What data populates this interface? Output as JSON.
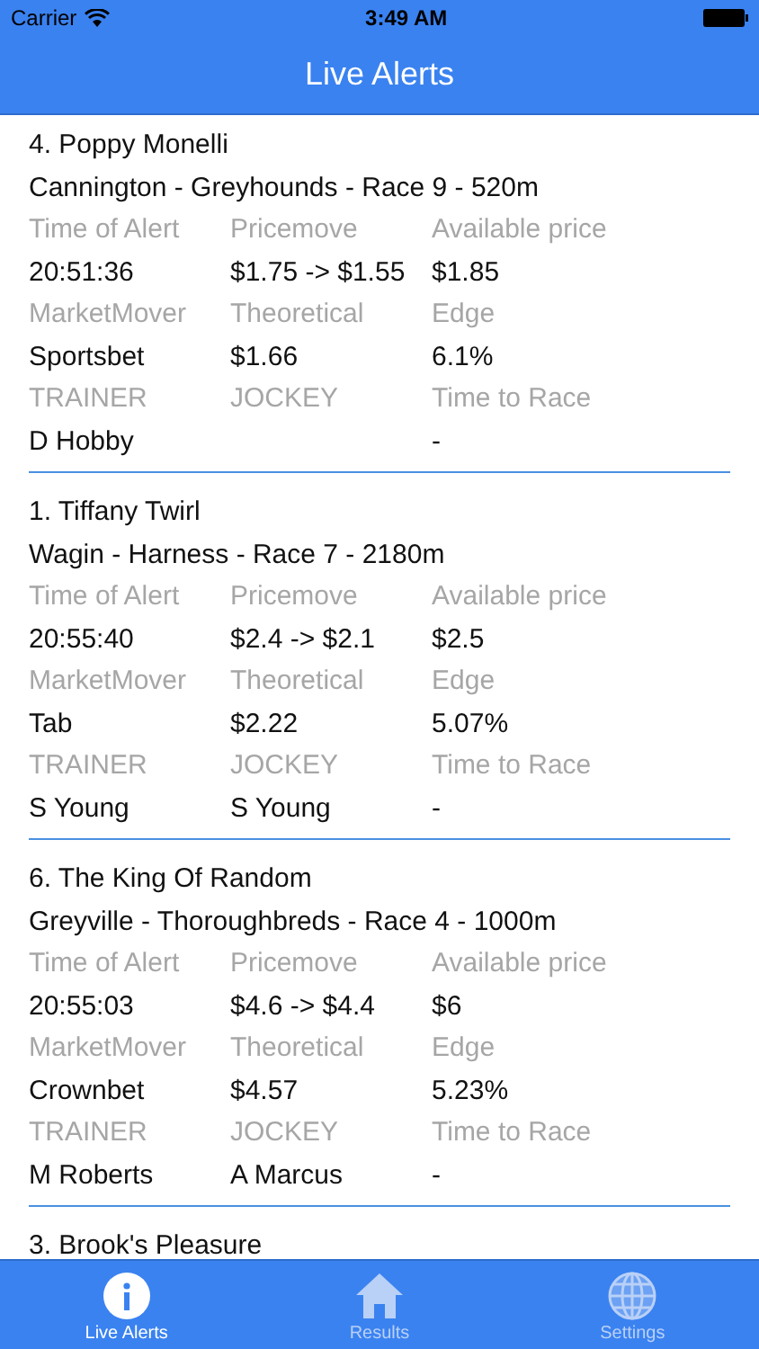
{
  "status_bar": {
    "carrier": "Carrier",
    "time": "3:49 AM"
  },
  "nav_bar": {
    "title": "Live Alerts"
  },
  "alerts": [
    {
      "title": "4. Poppy Monelli",
      "race": "Cannington - Greyhounds - Race 9 - 520m",
      "rows": [
        [
          {
            "label": "Time of Alert",
            "value": "20:51:36"
          },
          {
            "label": "Pricemove",
            "value": "$1.75 -> $1.55"
          },
          {
            "label": "Available price",
            "value": "$1.85"
          }
        ],
        [
          {
            "label": "MarketMover",
            "value": "Sportsbet"
          },
          {
            "label": "Theoretical",
            "value": "$1.66"
          },
          {
            "label": "Edge",
            "value": "6.1%"
          }
        ],
        [
          {
            "label": "TRAINER",
            "value": "D Hobby"
          },
          {
            "label": "JOCKEY"
          },
          {
            "label": "Time to Race",
            "value": "-"
          }
        ]
      ]
    },
    {
      "title": "1. Tiffany Twirl",
      "race": "Wagin - Harness - Race 7 - 2180m",
      "rows": [
        [
          {
            "label": "Time of Alert",
            "value": "20:55:40"
          },
          {
            "label": "Pricemove",
            "value": "$2.4 -> $2.1"
          },
          {
            "label": "Available price",
            "value": "$2.5"
          }
        ],
        [
          {
            "label": "MarketMover",
            "value": "Tab"
          },
          {
            "label": "Theoretical",
            "value": "$2.22"
          },
          {
            "label": "Edge",
            "value": "5.07%"
          }
        ],
        [
          {
            "label": "TRAINER",
            "value": "S Young"
          },
          {
            "label": "JOCKEY",
            "value": "S Young"
          },
          {
            "label": "Time to Race",
            "value": "-"
          }
        ]
      ]
    },
    {
      "title": "6. The King Of Random",
      "race": "Greyville - Thoroughbreds - Race 4 - 1000m",
      "rows": [
        [
          {
            "label": "Time of Alert",
            "value": "20:55:03"
          },
          {
            "label": "Pricemove",
            "value": "$4.6 -> $4.4"
          },
          {
            "label": "Available price",
            "value": "$6"
          }
        ],
        [
          {
            "label": "MarketMover",
            "value": "Crownbet"
          },
          {
            "label": "Theoretical",
            "value": "$4.57"
          },
          {
            "label": "Edge",
            "value": "5.23%"
          }
        ],
        [
          {
            "label": "TRAINER",
            "value": "M Roberts"
          },
          {
            "label": "JOCKEY",
            "value": "A Marcus"
          },
          {
            "label": "Time to Race",
            "value": "-"
          }
        ]
      ]
    },
    {
      "title": "3. Brook's Pleasure"
    }
  ],
  "tab_bar": [
    {
      "kind": "info",
      "label": "Live Alerts",
      "selected": true
    },
    {
      "kind": "home",
      "label": "Results",
      "selected": false
    },
    {
      "kind": "globe",
      "label": "Settings",
      "selected": false
    }
  ]
}
